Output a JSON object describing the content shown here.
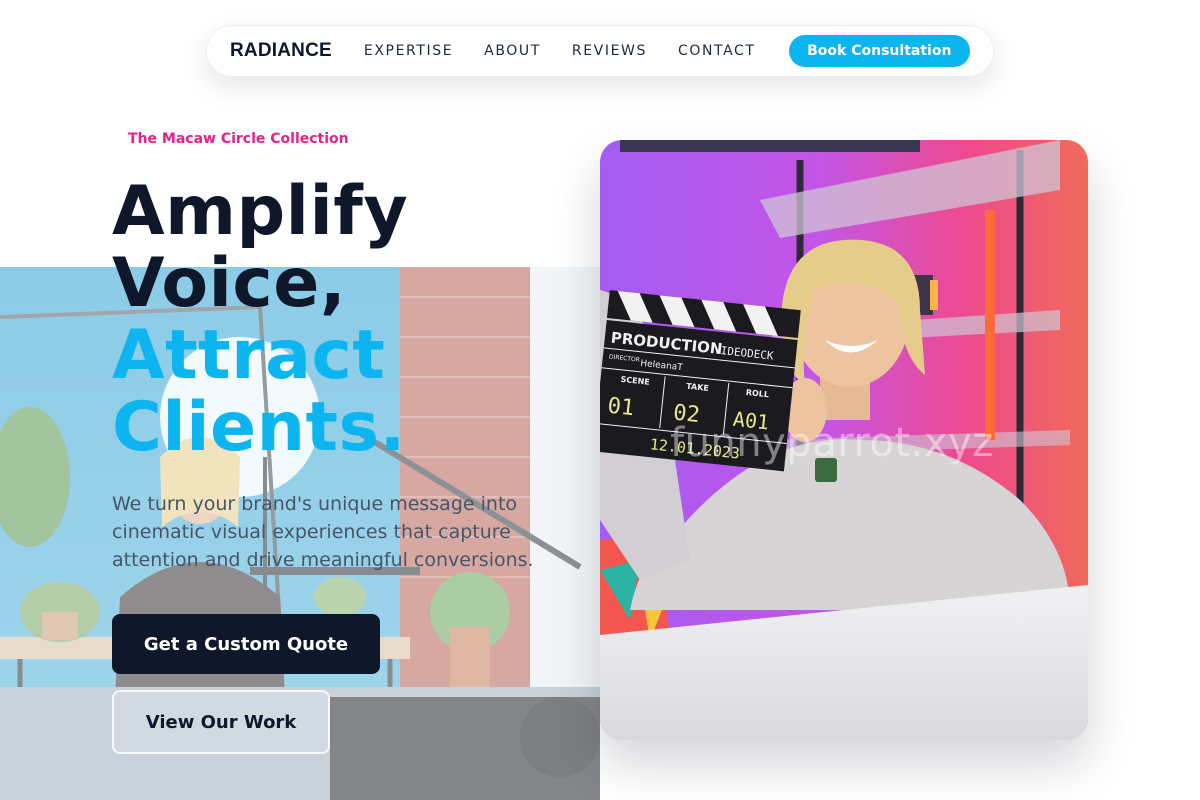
{
  "nav": {
    "brand": "RADIANCE",
    "links": [
      {
        "label": "EXPERTISE"
      },
      {
        "label": "ABOUT"
      },
      {
        "label": "REVIEWS"
      },
      {
        "label": "CONTACT"
      }
    ],
    "cta_label": "Book Consultation"
  },
  "hero": {
    "eyebrow": "The Macaw Circle Collection",
    "headline_lines": [
      "Amplify",
      "Voice,",
      "Attract",
      "Clients."
    ],
    "description": "We turn your brand's unique message into cinematic visual experiences that capture attention and drive meaningful conversions.",
    "primary_button": "Get a Custom Quote",
    "secondary_button": "View Our Work"
  },
  "media": {
    "clapper": {
      "title": "PRODUCTION",
      "brand_tag": "VIDEODECK",
      "director_label": "DIRECTOR",
      "director": "HeleanaT",
      "scene_label": "SCENE",
      "take_label": "TAKE",
      "roll_label": "ROLL",
      "scene": "01",
      "take": "02",
      "roll": "A01",
      "date": "12.01.2023"
    },
    "watermark": "funnyparrot.xyz"
  },
  "colors": {
    "accent": "#0cb4f0",
    "dark": "#0f172a",
    "eyebrow": "#e6218a",
    "body_text": "#475569"
  }
}
